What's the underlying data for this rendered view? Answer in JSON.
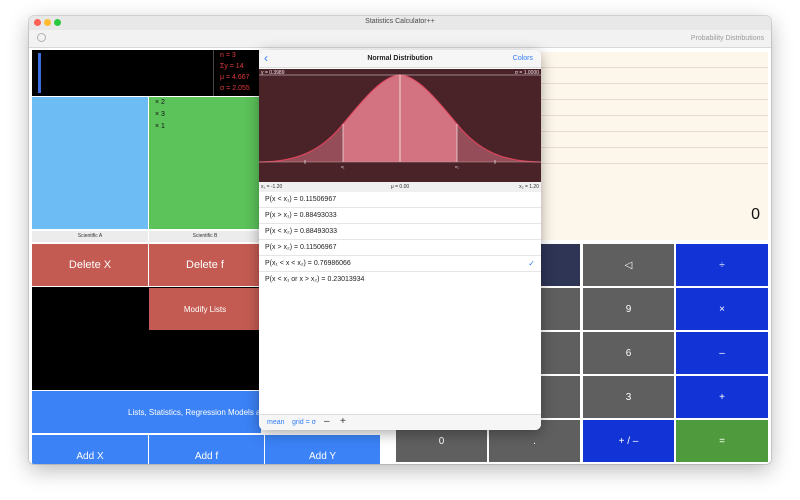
{
  "window": {
    "title": "Statistics Calculator++",
    "toolbar_right": "Probability Distributions"
  },
  "stats": {
    "n": "n = 3",
    "sum": "Σy = 14",
    "mean": "μ = 4.667",
    "sigma": "σ = 2.055"
  },
  "list_f": [
    "× 2",
    "× 3",
    "× 1"
  ],
  "tabs": {
    "a": "Scientific A",
    "b": "Scientific B"
  },
  "buttons": {
    "delete_x": "Delete X",
    "delete_f": "Delete f",
    "modify": "Modify Lists",
    "lists": "Lists, Statistics, Regression Models and",
    "add_x": "Add X",
    "add_f": "Add f",
    "add_y": "Add Y"
  },
  "calc": {
    "display": "0",
    "back": "◁",
    "divide": "÷",
    "nine": "9",
    "times": "×",
    "six": "6",
    "minus": "–",
    "three": "3",
    "plus": "+",
    "zero": "0",
    "dot": ".",
    "sign": "+ / –",
    "equals": "="
  },
  "popover": {
    "title": "Normal Distribution",
    "colors_label": "Colors",
    "y_label": "y = 0.3989",
    "sigma_label": "σ = 1.0000",
    "x1_label": "x₁ = -1.20",
    "mu_label": "μ = 0.00",
    "x2_label": "x₂ = 1.20",
    "x1_tick": "x₁",
    "x2_tick": "x₂",
    "rows": [
      "P(x < x₁) = 0.11506967",
      "P(x > x₁) = 0.88493033",
      "P(x < x₂) = 0.88493033",
      "P(x > x₂) = 0.11506967",
      "P(x₁ < x < x₂) = 0.76986066",
      "P(x < x₁ or x > x₂) = 0.23013934"
    ],
    "checkmark": "✓",
    "footer": {
      "mean": "mean",
      "grid": "grid = σ",
      "minus": "–",
      "plus": "+"
    }
  },
  "colors": {
    "red_button": "#c45b52",
    "blue_button": "#3b82f6",
    "calc_gray": "#5f5f5f",
    "calc_blue": "#1233d6",
    "calc_green": "#4f9a3c",
    "popover_plot": "#4a2329",
    "curve_fill": "#d37381",
    "stats_text": "#e03a3a"
  }
}
